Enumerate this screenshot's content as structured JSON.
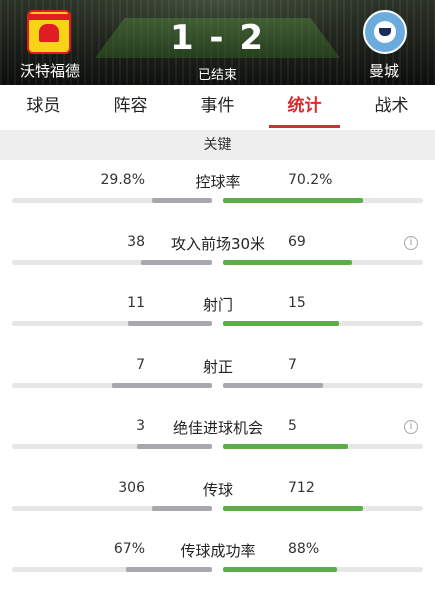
{
  "match": {
    "home_team": "沃特福德",
    "away_team": "曼城",
    "score": "1 - 2",
    "status": "已结束"
  },
  "tabs": [
    {
      "label": "球员",
      "active": false
    },
    {
      "label": "阵容",
      "active": false
    },
    {
      "label": "事件",
      "active": false
    },
    {
      "label": "统计",
      "active": true
    },
    {
      "label": "战术",
      "active": false
    }
  ],
  "section_title": "关键",
  "colors": {
    "home_bar": "#a8a8ac",
    "away_win": "#5cad48",
    "away_neutral": "#a8a8ac",
    "accent": "#d92b2b"
  },
  "stats": [
    {
      "label": "控球率",
      "home": "29.8%",
      "away": "70.2%",
      "home_frac": 0.298,
      "away_frac": 0.702,
      "info": false
    },
    {
      "label": "攻入前场30米",
      "home": "38",
      "away": "69",
      "home_frac": 0.355,
      "away_frac": 0.645,
      "info": true
    },
    {
      "label": "射门",
      "home": "11",
      "away": "15",
      "home_frac": 0.42,
      "away_frac": 0.58,
      "info": false
    },
    {
      "label": "射正",
      "home": "7",
      "away": "7",
      "home_frac": 0.5,
      "away_frac": 0.5,
      "info": false
    },
    {
      "label": "绝佳进球机会",
      "home": "3",
      "away": "5",
      "home_frac": 0.375,
      "away_frac": 0.625,
      "info": true
    },
    {
      "label": "传球",
      "home": "306",
      "away": "712",
      "home_frac": 0.3,
      "away_frac": 0.7,
      "info": false
    },
    {
      "label": "传球成功率",
      "home": "67%",
      "away": "88%",
      "home_frac": 0.43,
      "away_frac": 0.57,
      "info": false
    }
  ]
}
